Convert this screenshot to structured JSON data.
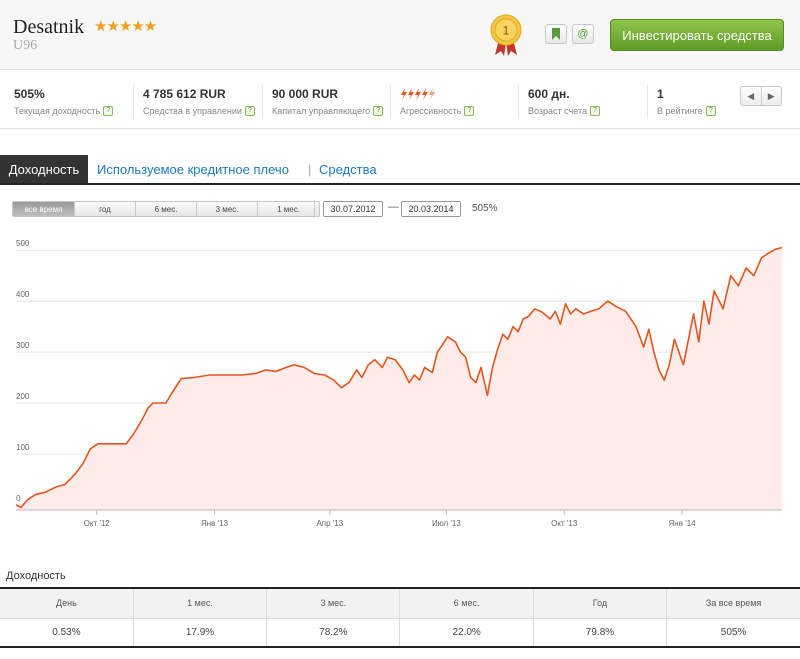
{
  "header": {
    "name": "Desatnik",
    "stars": "★★★★★",
    "subtitle": "U96",
    "medal_number": "1",
    "bookmark_icon": "bookmark-icon",
    "email_icon": "@",
    "invest_button": "Инвестировать средства"
  },
  "stats": [
    {
      "value": "505%",
      "label": "Текущая доходность"
    },
    {
      "value": "4 785 612 RUR",
      "label": "Средства в управлении"
    },
    {
      "value": "90 000 RUR",
      "label": "Капитал управляющего"
    },
    {
      "value": "",
      "label": "Агрессивность",
      "level": 4.5,
      "max": 5
    },
    {
      "value": "600 дн.",
      "label": "Возраст счета"
    },
    {
      "value": "1",
      "label": "В рейтинге"
    }
  ],
  "help_glyph": "?",
  "rating_nav": {
    "prev": "◀",
    "next": "▶"
  },
  "tabs": {
    "active": "Доходность",
    "items": [
      "Используемое кредитное плечо",
      "Средства"
    ],
    "separator": "|"
  },
  "range": {
    "buttons": [
      "все время",
      "год",
      "6 мес.",
      "3 мес.",
      "1 мес."
    ],
    "active_index": 0,
    "date_from": "30.07.2012",
    "date_to": "20.03.2014",
    "dash": "—",
    "percent": "505%"
  },
  "colors": {
    "line": "#e8541e",
    "fill": "#fdecea",
    "accent_green": "#6aa82f",
    "link": "#1a7bbf"
  },
  "chart_data": {
    "type": "area",
    "title": "",
    "xlabel": "",
    "ylabel": "",
    "ylim": [
      -10,
      520
    ],
    "yticks": [
      0,
      100,
      200,
      300,
      400,
      500
    ],
    "ytick_labels": [
      "0",
      "100",
      "200",
      "300",
      "400",
      "500"
    ],
    "xticks": [
      {
        "date": "2012-10-01",
        "label": "Окт '12"
      },
      {
        "date": "2013-01-01",
        "label": "Янв '13"
      },
      {
        "date": "2013-04-01",
        "label": "Апр '13"
      },
      {
        "date": "2013-07-01",
        "label": "Июл '13"
      },
      {
        "date": "2013-10-01",
        "label": "Окт '13"
      },
      {
        "date": "2014-01-01",
        "label": "Янв '14"
      }
    ],
    "xlim": [
      "2012-07-30",
      "2014-03-20"
    ],
    "grid": true,
    "series": [
      {
        "points": [
          [
            "2012-07-30",
            0
          ],
          [
            "2012-08-03",
            -5
          ],
          [
            "2012-08-08",
            10
          ],
          [
            "2012-08-14",
            20
          ],
          [
            "2012-08-22",
            25
          ],
          [
            "2012-08-30",
            35
          ],
          [
            "2012-09-06",
            40
          ],
          [
            "2012-09-14",
            60
          ],
          [
            "2012-09-20",
            80
          ],
          [
            "2012-09-26",
            110
          ],
          [
            "2012-10-02",
            120
          ],
          [
            "2012-10-12",
            120
          ],
          [
            "2012-10-24",
            120
          ],
          [
            "2012-10-30",
            140
          ],
          [
            "2012-11-06",
            170
          ],
          [
            "2012-11-10",
            190
          ],
          [
            "2012-11-14",
            200
          ],
          [
            "2012-11-24",
            200
          ],
          [
            "2012-11-30",
            225
          ],
          [
            "2012-12-06",
            248
          ],
          [
            "2012-12-16",
            250
          ],
          [
            "2012-12-28",
            255
          ],
          [
            "2013-01-10",
            255
          ],
          [
            "2013-01-22",
            255
          ],
          [
            "2013-02-02",
            258
          ],
          [
            "2013-02-10",
            265
          ],
          [
            "2013-02-18",
            262
          ],
          [
            "2013-02-26",
            270
          ],
          [
            "2013-03-04",
            275
          ],
          [
            "2013-03-12",
            270
          ],
          [
            "2013-03-20",
            258
          ],
          [
            "2013-03-28",
            255
          ],
          [
            "2013-04-04",
            245
          ],
          [
            "2013-04-10",
            230
          ],
          [
            "2013-04-16",
            240
          ],
          [
            "2013-04-22",
            265
          ],
          [
            "2013-04-26",
            250
          ],
          [
            "2013-05-01",
            275
          ],
          [
            "2013-05-06",
            285
          ],
          [
            "2013-05-12",
            270
          ],
          [
            "2013-05-16",
            290
          ],
          [
            "2013-05-22",
            285
          ],
          [
            "2013-05-28",
            265
          ],
          [
            "2013-06-02",
            240
          ],
          [
            "2013-06-06",
            255
          ],
          [
            "2013-06-10",
            245
          ],
          [
            "2013-06-14",
            270
          ],
          [
            "2013-06-20",
            260
          ],
          [
            "2013-06-24",
            300
          ],
          [
            "2013-06-28",
            315
          ],
          [
            "2013-07-02",
            330
          ],
          [
            "2013-07-08",
            320
          ],
          [
            "2013-07-12",
            300
          ],
          [
            "2013-07-16",
            290
          ],
          [
            "2013-07-20",
            250
          ],
          [
            "2013-07-24",
            240
          ],
          [
            "2013-07-28",
            270
          ],
          [
            "2013-08-02",
            215
          ],
          [
            "2013-08-06",
            270
          ],
          [
            "2013-08-10",
            305
          ],
          [
            "2013-08-14",
            335
          ],
          [
            "2013-08-18",
            325
          ],
          [
            "2013-08-22",
            350
          ],
          [
            "2013-08-26",
            340
          ],
          [
            "2013-08-30",
            365
          ],
          [
            "2013-09-03",
            370
          ],
          [
            "2013-09-08",
            385
          ],
          [
            "2013-09-14",
            378
          ],
          [
            "2013-09-20",
            365
          ],
          [
            "2013-09-24",
            380
          ],
          [
            "2013-09-28",
            355
          ],
          [
            "2013-10-02",
            395
          ],
          [
            "2013-10-06",
            375
          ],
          [
            "2013-10-10",
            385
          ],
          [
            "2013-10-16",
            375
          ],
          [
            "2013-10-22",
            380
          ],
          [
            "2013-10-28",
            385
          ],
          [
            "2013-11-04",
            400
          ],
          [
            "2013-11-10",
            390
          ],
          [
            "2013-11-18",
            380
          ],
          [
            "2013-11-26",
            350
          ],
          [
            "2013-12-02",
            310
          ],
          [
            "2013-12-06",
            345
          ],
          [
            "2013-12-10",
            300
          ],
          [
            "2013-12-14",
            265
          ],
          [
            "2013-12-18",
            245
          ],
          [
            "2013-12-22",
            275
          ],
          [
            "2013-12-26",
            325
          ],
          [
            "2014-01-02",
            275
          ],
          [
            "2014-01-06",
            325
          ],
          [
            "2014-01-10",
            375
          ],
          [
            "2014-01-14",
            320
          ],
          [
            "2014-01-18",
            400
          ],
          [
            "2014-01-22",
            355
          ],
          [
            "2014-01-26",
            420
          ],
          [
            "2014-02-02",
            385
          ],
          [
            "2014-02-08",
            450
          ],
          [
            "2014-02-14",
            430
          ],
          [
            "2014-02-20",
            465
          ],
          [
            "2014-02-26",
            450
          ],
          [
            "2014-03-04",
            485
          ],
          [
            "2014-03-10",
            495
          ],
          [
            "2014-03-15",
            502
          ],
          [
            "2014-03-20",
            505
          ]
        ]
      }
    ]
  },
  "returns": {
    "title": "Доходность",
    "headers": [
      "День",
      "1 мес.",
      "3 мес.",
      "6 мес.",
      "Год",
      "За все время"
    ],
    "values": [
      "0.53%",
      "17.9%",
      "78.2%",
      "22.0%",
      "79.8%",
      "505%"
    ]
  }
}
